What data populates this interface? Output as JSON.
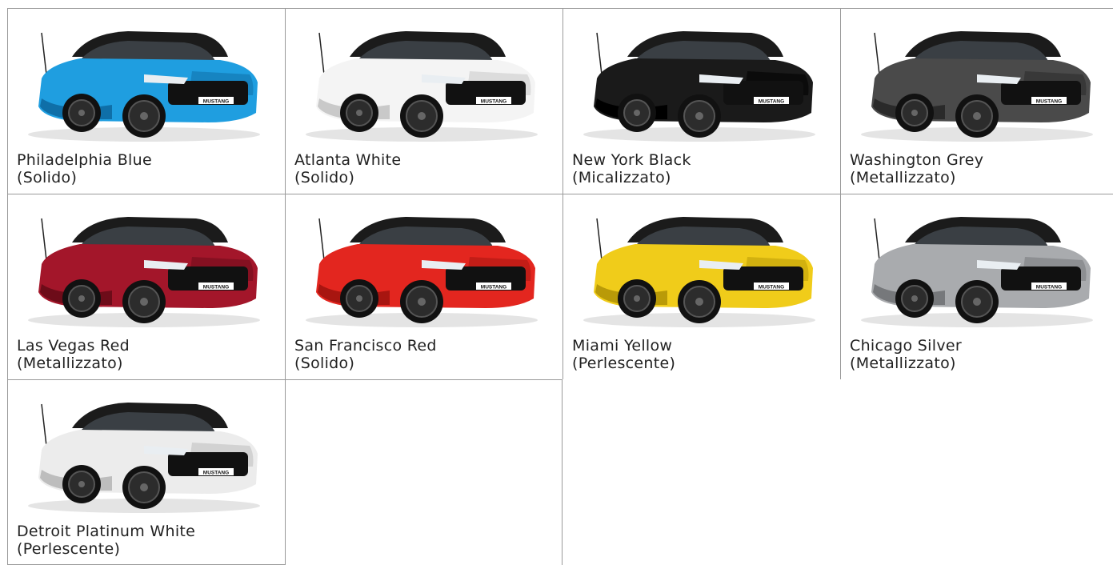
{
  "swatches": [
    {
      "name": "Philadelphia Blue",
      "finish": "(Solido)",
      "body": "#1f9ee0",
      "shade": "#0f6fa8",
      "plate": "MUSTANG"
    },
    {
      "name": "Atlanta White",
      "finish": "(Solido)",
      "body": "#f4f4f4",
      "shade": "#c9c9c9",
      "plate": "MUSTANG"
    },
    {
      "name": "New York Black",
      "finish": "(Micalizzato)",
      "body": "#1a1a1a",
      "shade": "#000000",
      "plate": "MUSTANG"
    },
    {
      "name": "Washington Grey",
      "finish": "(Metallizzato)",
      "body": "#4a4a4a",
      "shade": "#2a2a2a",
      "plate": "MUSTANG"
    },
    {
      "name": "Las Vegas Red",
      "finish": "(Metallizzato)",
      "body": "#a3162a",
      "shade": "#6d0c19",
      "plate": "MUSTANG"
    },
    {
      "name": "San Francisco Red",
      "finish": "(Solido)",
      "body": "#e3261f",
      "shade": "#a81510",
      "plate": "MUSTANG"
    },
    {
      "name": "Miami Yellow",
      "finish": "(Perlescente)",
      "body": "#f0cc1a",
      "shade": "#b99a08",
      "plate": "MUSTANG"
    },
    {
      "name": "Chicago Silver",
      "finish": "(Metallizzato)",
      "body": "#a9abae",
      "shade": "#76787b",
      "plate": "MUSTANG"
    },
    {
      "name": "Detroit Platinum White",
      "finish": "(Perlescente)",
      "body": "#ececec",
      "shade": "#bdbdbd",
      "plate": "MUSTANG"
    }
  ]
}
